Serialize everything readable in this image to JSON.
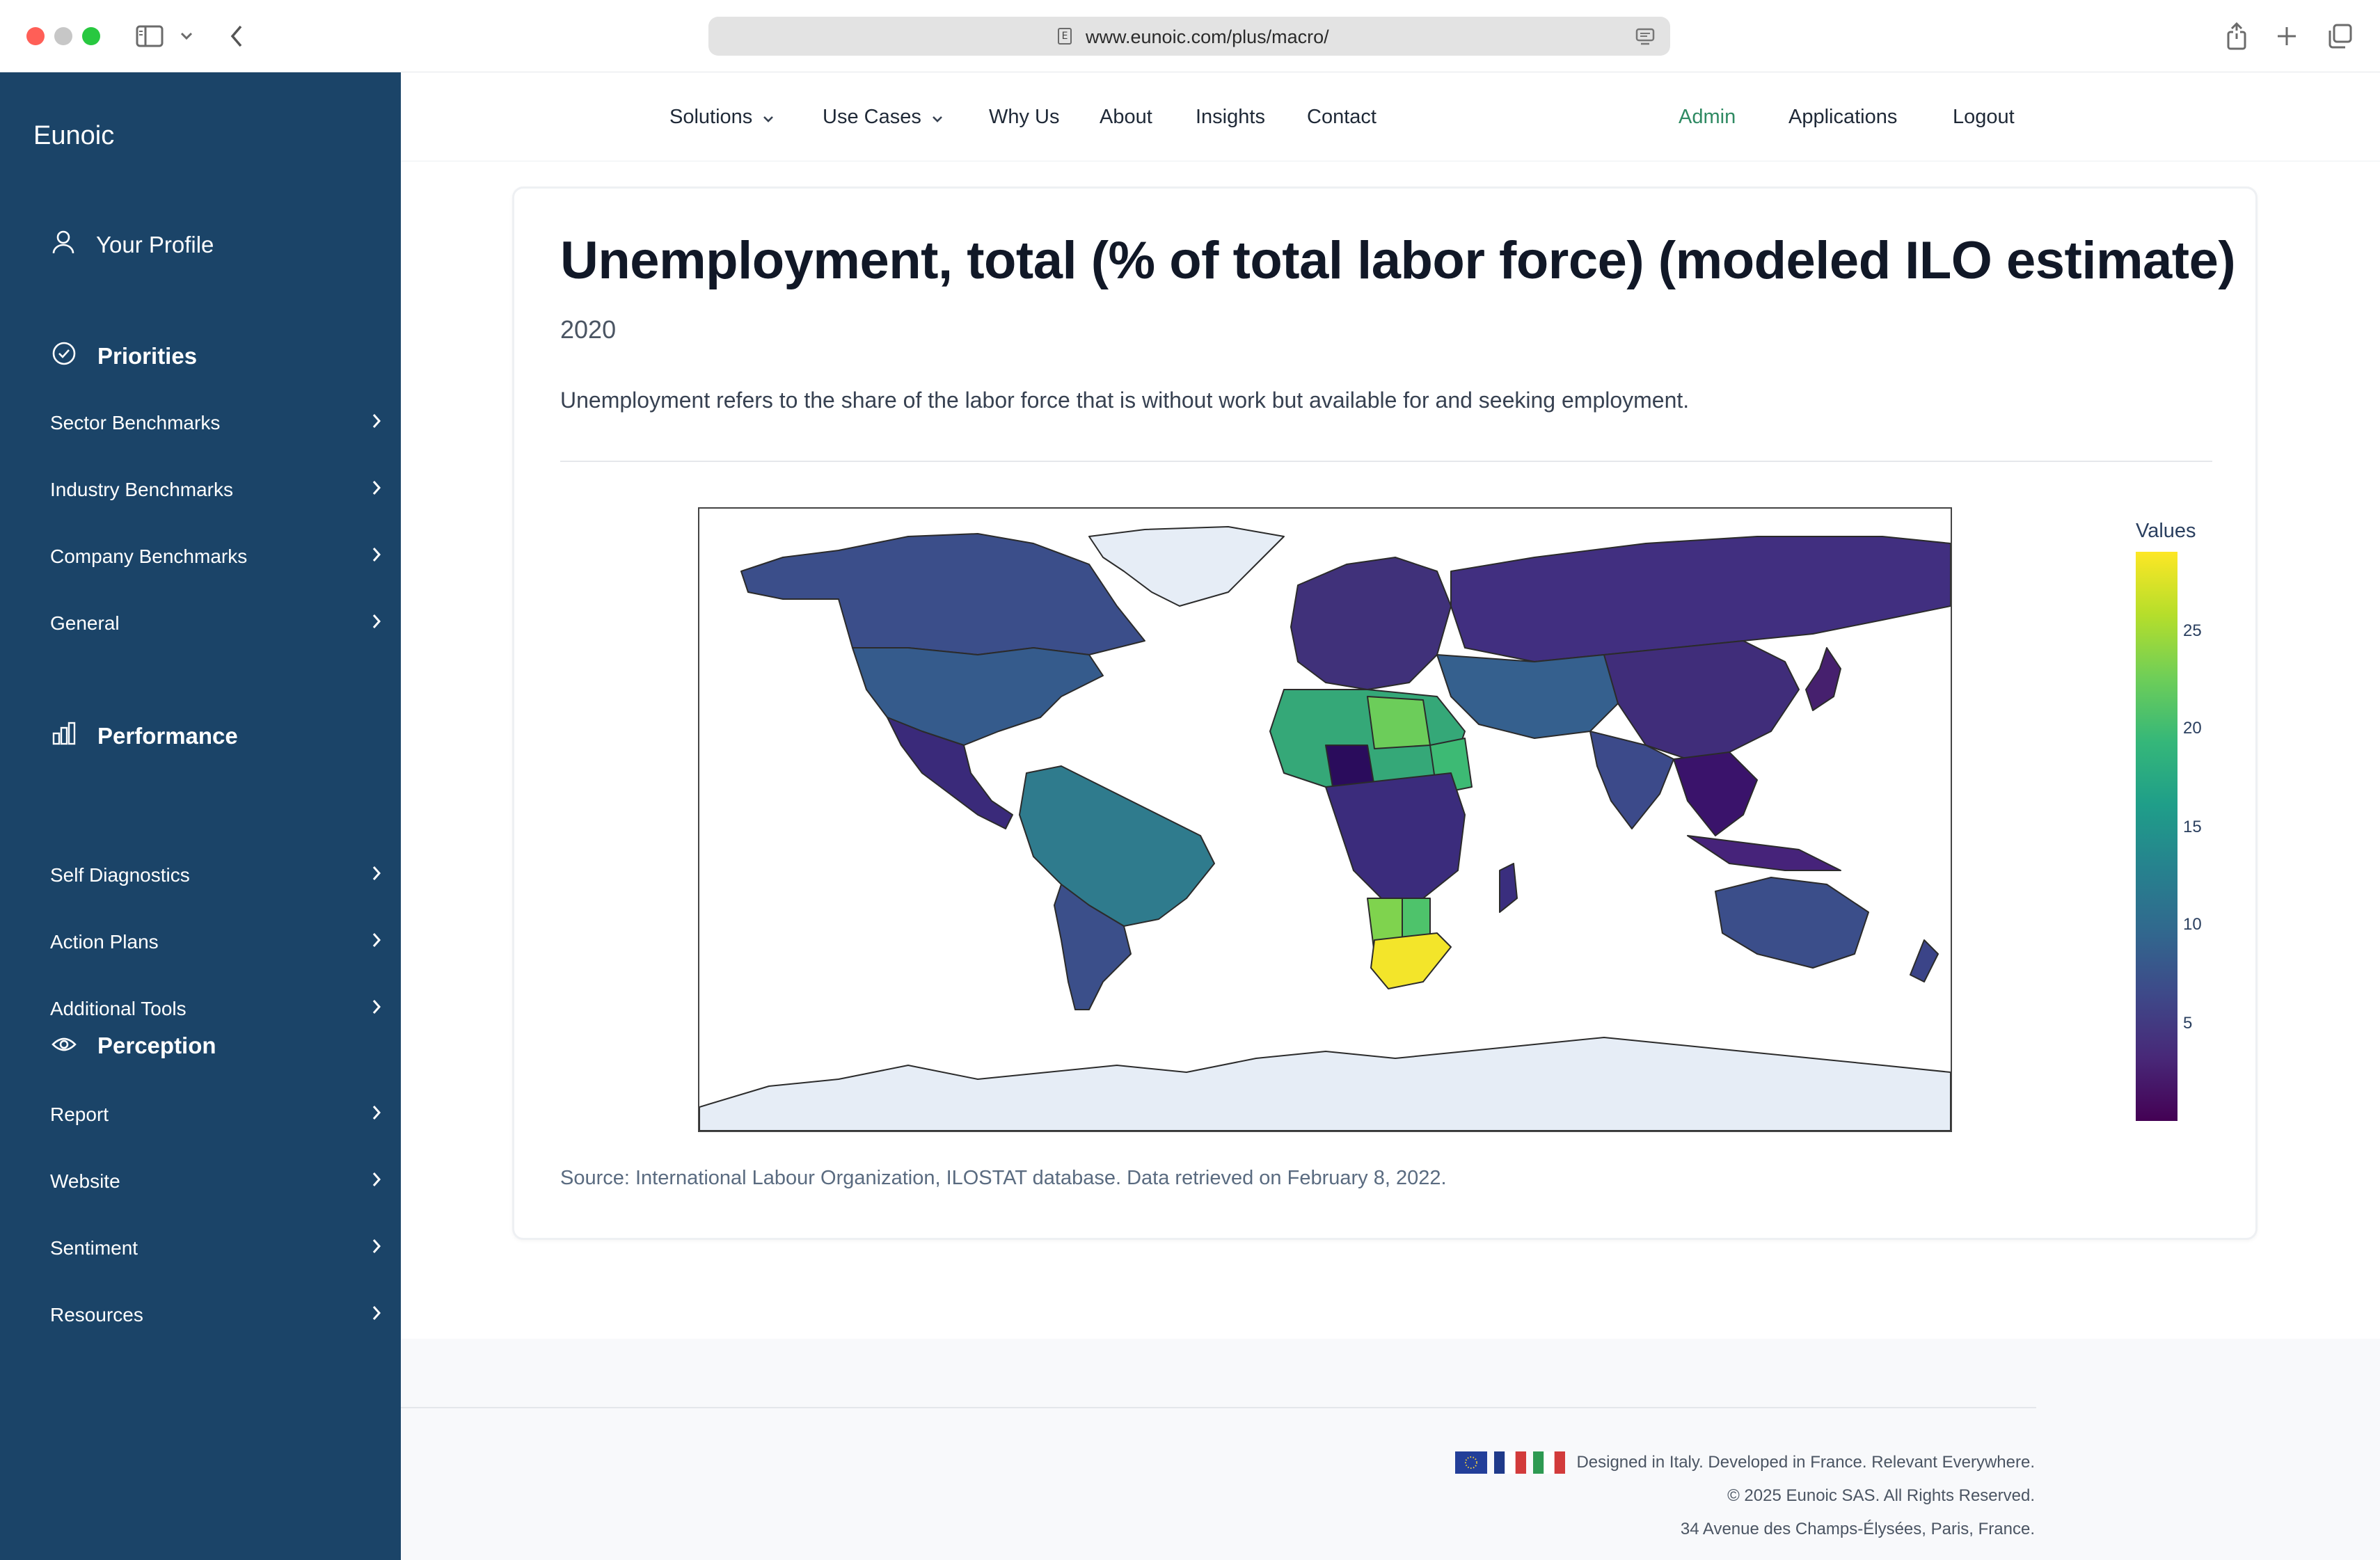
{
  "browser": {
    "url": "www.eunoic.com/plus/macro/",
    "url_badge": "E"
  },
  "sidebar": {
    "brand": "Eunoic",
    "profile_label": "Your Profile",
    "sections": [
      {
        "label": "Priorities",
        "items": [
          "Sector Benchmarks",
          "Industry Benchmarks",
          "Company Benchmarks",
          "General"
        ]
      },
      {
        "label": "Performance",
        "items": [
          "Self Diagnostics",
          "Action Plans",
          "Additional Tools"
        ]
      },
      {
        "label": "Perception",
        "items": [
          "Report",
          "Website",
          "Sentiment",
          "Resources"
        ]
      }
    ]
  },
  "nav": {
    "items": [
      "Solutions",
      "Use Cases",
      "Why Us",
      "About",
      "Insights",
      "Contact"
    ],
    "admin": "Admin",
    "applications": "Applications",
    "logout": "Logout",
    "accent_color": "#2f8a63"
  },
  "main": {
    "title": "Unemployment, total (% of total labor force) (modeled ILO estimate)",
    "year": "2020",
    "description": "Unemployment refers to the share of the labor force that is without work but available for and seeking employment.",
    "source": "Source: International Labour Organization, ILOSTAT database. Data retrieved on February 8, 2022."
  },
  "map": {
    "type": "choropleth",
    "colorscale": "viridis",
    "legend_title": "Values",
    "legend_ticks": [
      "25",
      "20",
      "15",
      "10",
      "5"
    ],
    "range": [
      0,
      29
    ],
    "highlights": [
      {
        "region": "South Africa",
        "value": 29
      },
      {
        "region": "Namibia",
        "value": 21
      },
      {
        "region": "Botswana",
        "value": 18
      },
      {
        "region": "Libya",
        "value": 19.5
      },
      {
        "region": "Sudan",
        "value": 17
      },
      {
        "region": "Brazil",
        "value": 13.5
      },
      {
        "region": "Russia",
        "value": 5.6
      },
      {
        "region": "China",
        "value": 5
      },
      {
        "region": "Canada",
        "value": 9.5
      },
      {
        "region": "United States",
        "value": 8
      },
      {
        "region": "Australia",
        "value": 6.5
      },
      {
        "region": "Niger",
        "value": 0.5
      }
    ]
  },
  "footer": {
    "tagline": "Designed in Italy. Developed in France. Relevant Everywhere.",
    "copyright": "© 2025 Eunoic SAS. All Rights Reserved.",
    "address": "34 Avenue des Champs-Élysées, Paris, France."
  }
}
